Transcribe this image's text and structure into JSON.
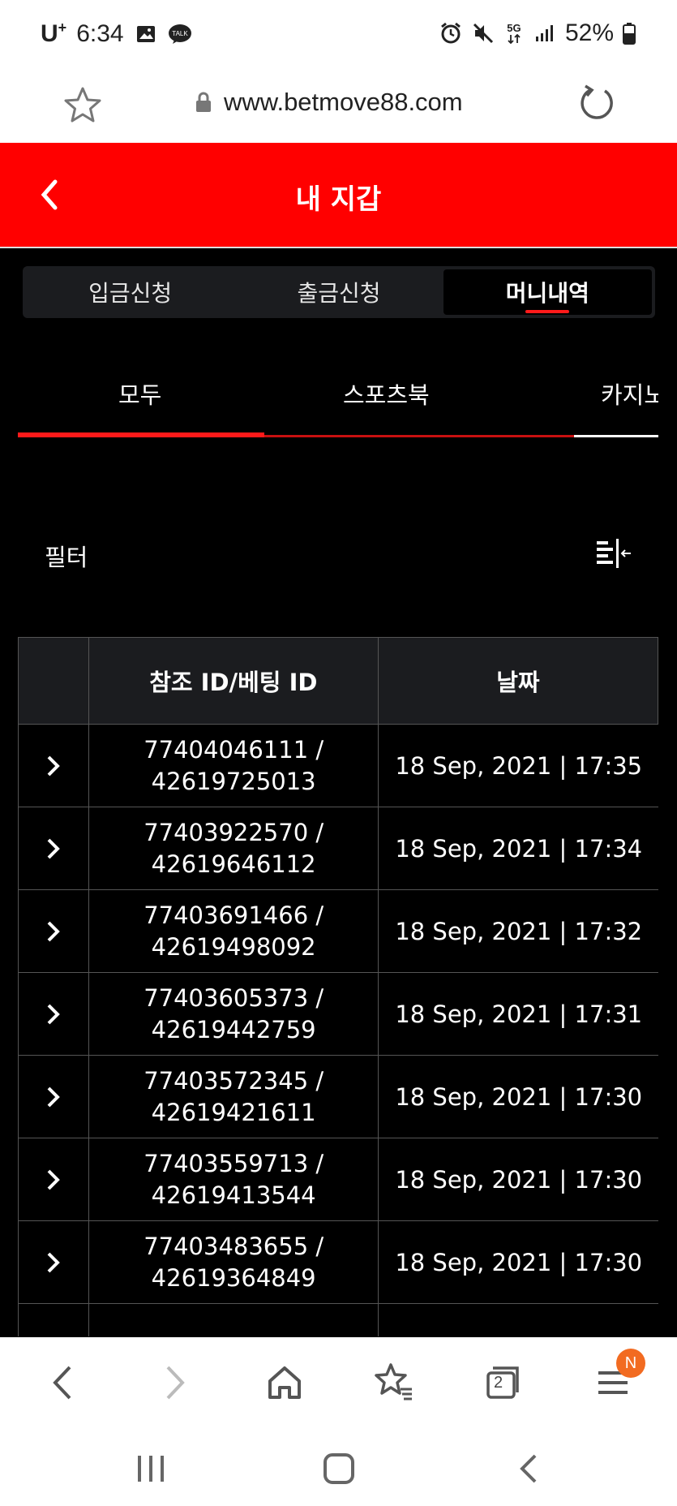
{
  "status_bar": {
    "carrier": "U",
    "carrier_sup": "+",
    "time": "6:34",
    "network": "5G",
    "battery": "52%"
  },
  "browser": {
    "url": "www.betmove88.com"
  },
  "header": {
    "title": "내 지갑",
    "accent_color": "#ff0000"
  },
  "main_tabs": [
    {
      "label": "입금신청",
      "active": false
    },
    {
      "label": "출금신청",
      "active": false
    },
    {
      "label": "머니내역",
      "active": true
    }
  ],
  "sub_tabs": [
    {
      "label": "모두",
      "active": true
    },
    {
      "label": "스포츠북",
      "active": false
    },
    {
      "label": "카지노",
      "active": false
    }
  ],
  "filter": {
    "label": "필터"
  },
  "table": {
    "headers": [
      "",
      "참조 ID/베팅 ID",
      "날짜"
    ],
    "rows": [
      {
        "ref_id": "77404046111 /",
        "bet_id": "42619725013",
        "date": "18 Sep, 2021 | 17:35"
      },
      {
        "ref_id": "77403922570 /",
        "bet_id": "42619646112",
        "date": "18 Sep, 2021 | 17:34"
      },
      {
        "ref_id": "77403691466 /",
        "bet_id": "42619498092",
        "date": "18 Sep, 2021 | 17:32"
      },
      {
        "ref_id": "77403605373 /",
        "bet_id": "42619442759",
        "date": "18 Sep, 2021 | 17:31"
      },
      {
        "ref_id": "77403572345 /",
        "bet_id": "42619421611",
        "date": "18 Sep, 2021 | 17:30"
      },
      {
        "ref_id": "77403559713 /",
        "bet_id": "42619413544",
        "date": "18 Sep, 2021 | 17:30"
      },
      {
        "ref_id": "77403483655 /",
        "bet_id": "42619364849",
        "date": "18 Sep, 2021 | 17:30"
      }
    ]
  },
  "bottom_nav": {
    "tab_count": "2",
    "menu_badge": "N"
  }
}
